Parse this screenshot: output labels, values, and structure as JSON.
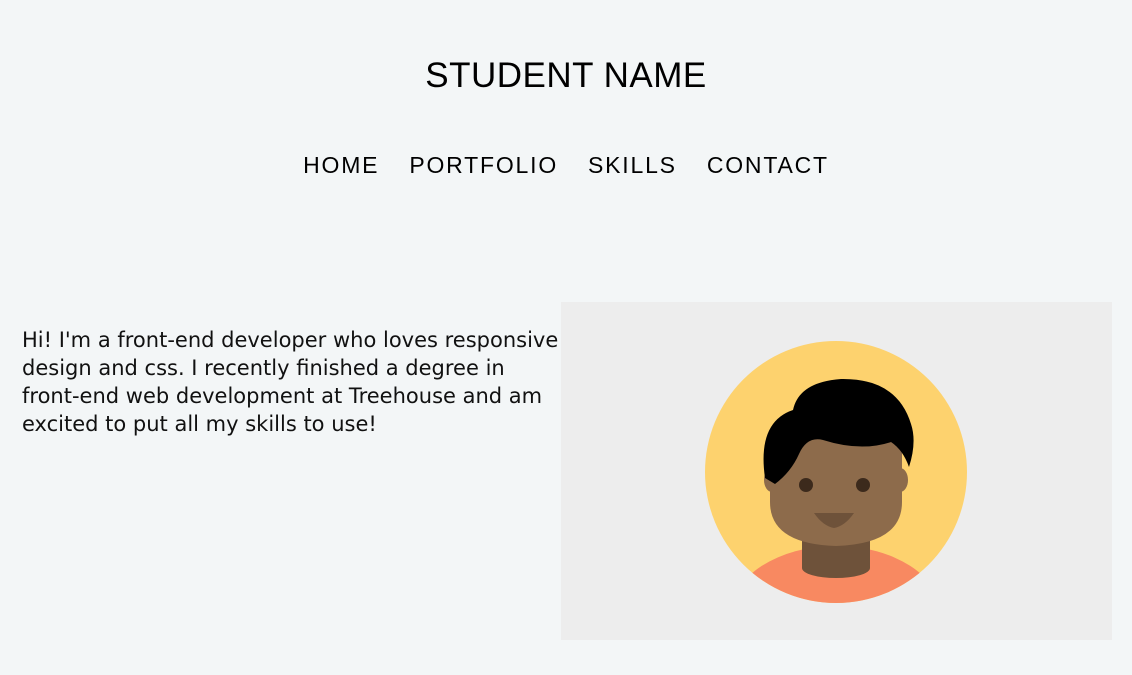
{
  "header": {
    "title": "STUDENT NAME"
  },
  "nav": {
    "items": [
      {
        "label": "HOME"
      },
      {
        "label": "PORTFOLIO"
      },
      {
        "label": "SKILLS"
      },
      {
        "label": "CONTACT"
      }
    ]
  },
  "intro": {
    "text": "Hi! I'm a front-end developer who loves responsive design and css. I recently finished a degree in front-end web development at Treehouse and am excited to put all my skills to use!"
  },
  "avatar": {
    "icon": "person-avatar-icon",
    "colors": {
      "panel": "#ededed",
      "circle": "#fdd26e",
      "skin": "#8d6b4b",
      "neck": "#6e523a",
      "hair": "#000000",
      "shirt": "#f88961"
    }
  },
  "colors": {
    "background": "#f3f6f7",
    "text": "#111111"
  }
}
